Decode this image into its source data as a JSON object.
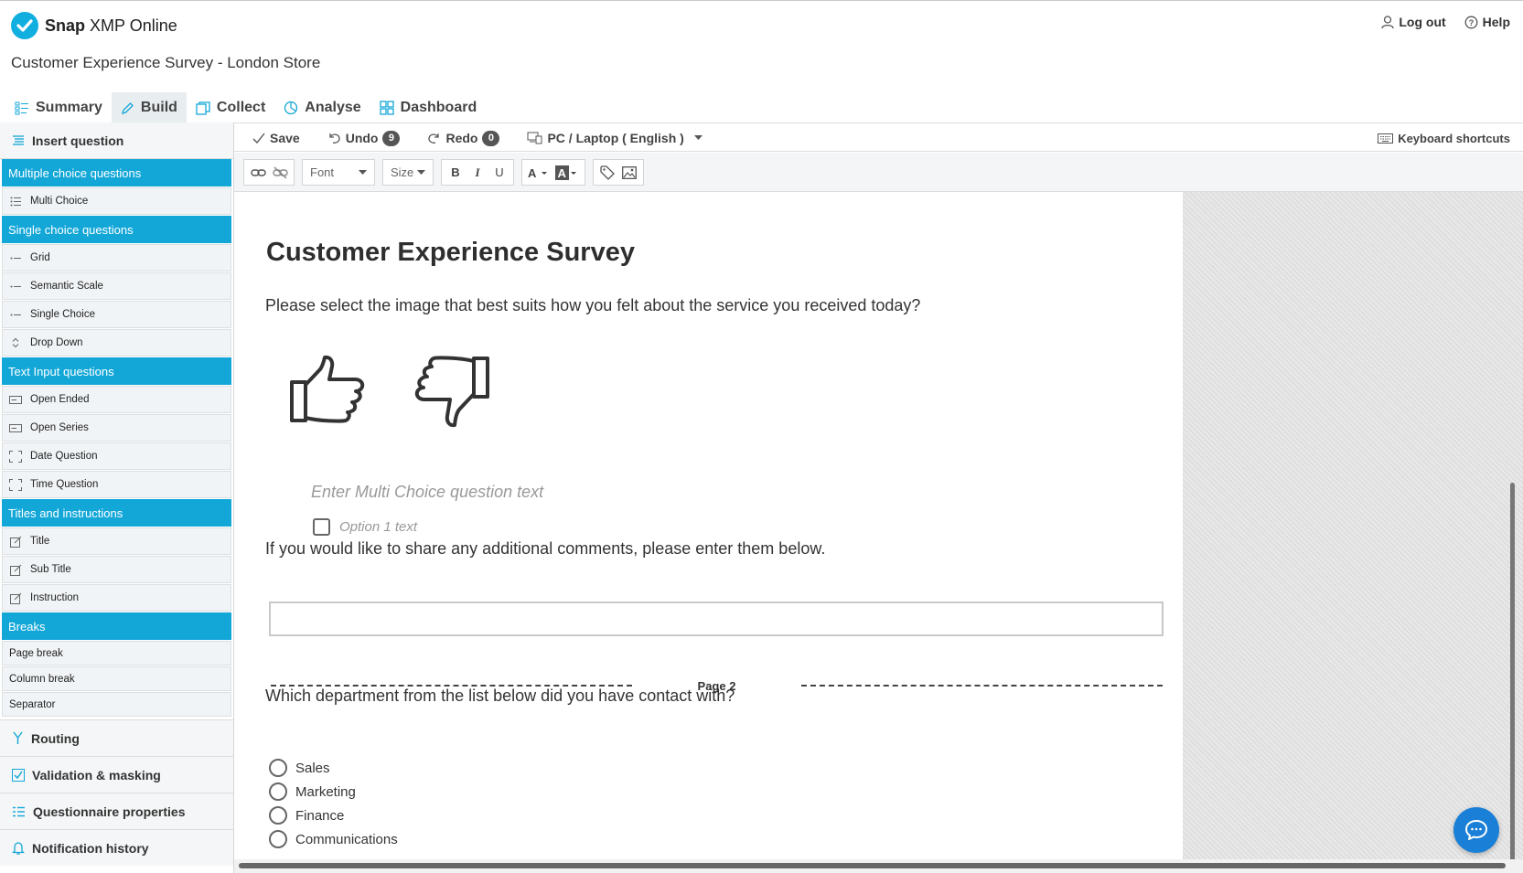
{
  "app": {
    "brand_bold": "Snap",
    "brand_rest": " XMP Online",
    "accent_color": "#13a7d8"
  },
  "header": {
    "logout_label": "Log out",
    "help_label": "Help",
    "survey_title": "Customer Experience Survey - London Store"
  },
  "main_tabs": [
    {
      "label": "Summary",
      "icon": "summary-icon"
    },
    {
      "label": "Build",
      "icon": "pencil-icon",
      "active": true
    },
    {
      "label": "Collect",
      "icon": "collect-icon"
    },
    {
      "label": "Analyse",
      "icon": "analyse-icon"
    },
    {
      "label": "Dashboard",
      "icon": "dashboard-icon"
    }
  ],
  "sidebar": {
    "insert_question": "Insert question",
    "categories": {
      "multiple": "Multiple choice questions",
      "single": "Single choice questions",
      "text": "Text Input questions",
      "titles": "Titles and instructions",
      "breaks": "Breaks"
    },
    "items": {
      "multi_choice": "Multi Choice",
      "grid": "Grid",
      "semantic_scale": "Semantic Scale",
      "single_choice": "Single Choice",
      "drop_down": "Drop Down",
      "open_ended": "Open Ended",
      "open_series": "Open Series",
      "date_question": "Date Question",
      "time_question": "Time Question",
      "title": "Title",
      "sub_title": "Sub Title",
      "instruction": "Instruction",
      "page_break": "Page break",
      "column_break": "Column break",
      "separator": "Separator"
    },
    "footer": {
      "routing": "Routing",
      "validation": "Validation & masking",
      "properties": "Questionnaire properties",
      "notification": "Notification history"
    }
  },
  "toolbar": {
    "save_label": "Save",
    "undo_label": "Undo",
    "undo_count": "9",
    "redo_label": "Redo",
    "redo_count": "0",
    "device_label": "PC / Laptop ( English )",
    "shortcuts_label": "Keyboard shortcuts",
    "font_placeholder": "Font",
    "size_placeholder": "Size",
    "bold": "B",
    "italic": "I",
    "underline": "U"
  },
  "survey": {
    "heading": "Customer Experience Survey",
    "q1_text": "Please select the image that best suits how you felt about the service you received today?",
    "mc_placeholder": "Enter Multi Choice question text",
    "option1_placeholder": "Option 1 text",
    "q2_text": "If you would like to share any additional comments, please enter them below.",
    "page_break_label": "Page 2",
    "q3_text": "Which department from the list below did you have contact with?",
    "q3_options": [
      "Sales",
      "Marketing",
      "Finance",
      "Communications"
    ]
  }
}
